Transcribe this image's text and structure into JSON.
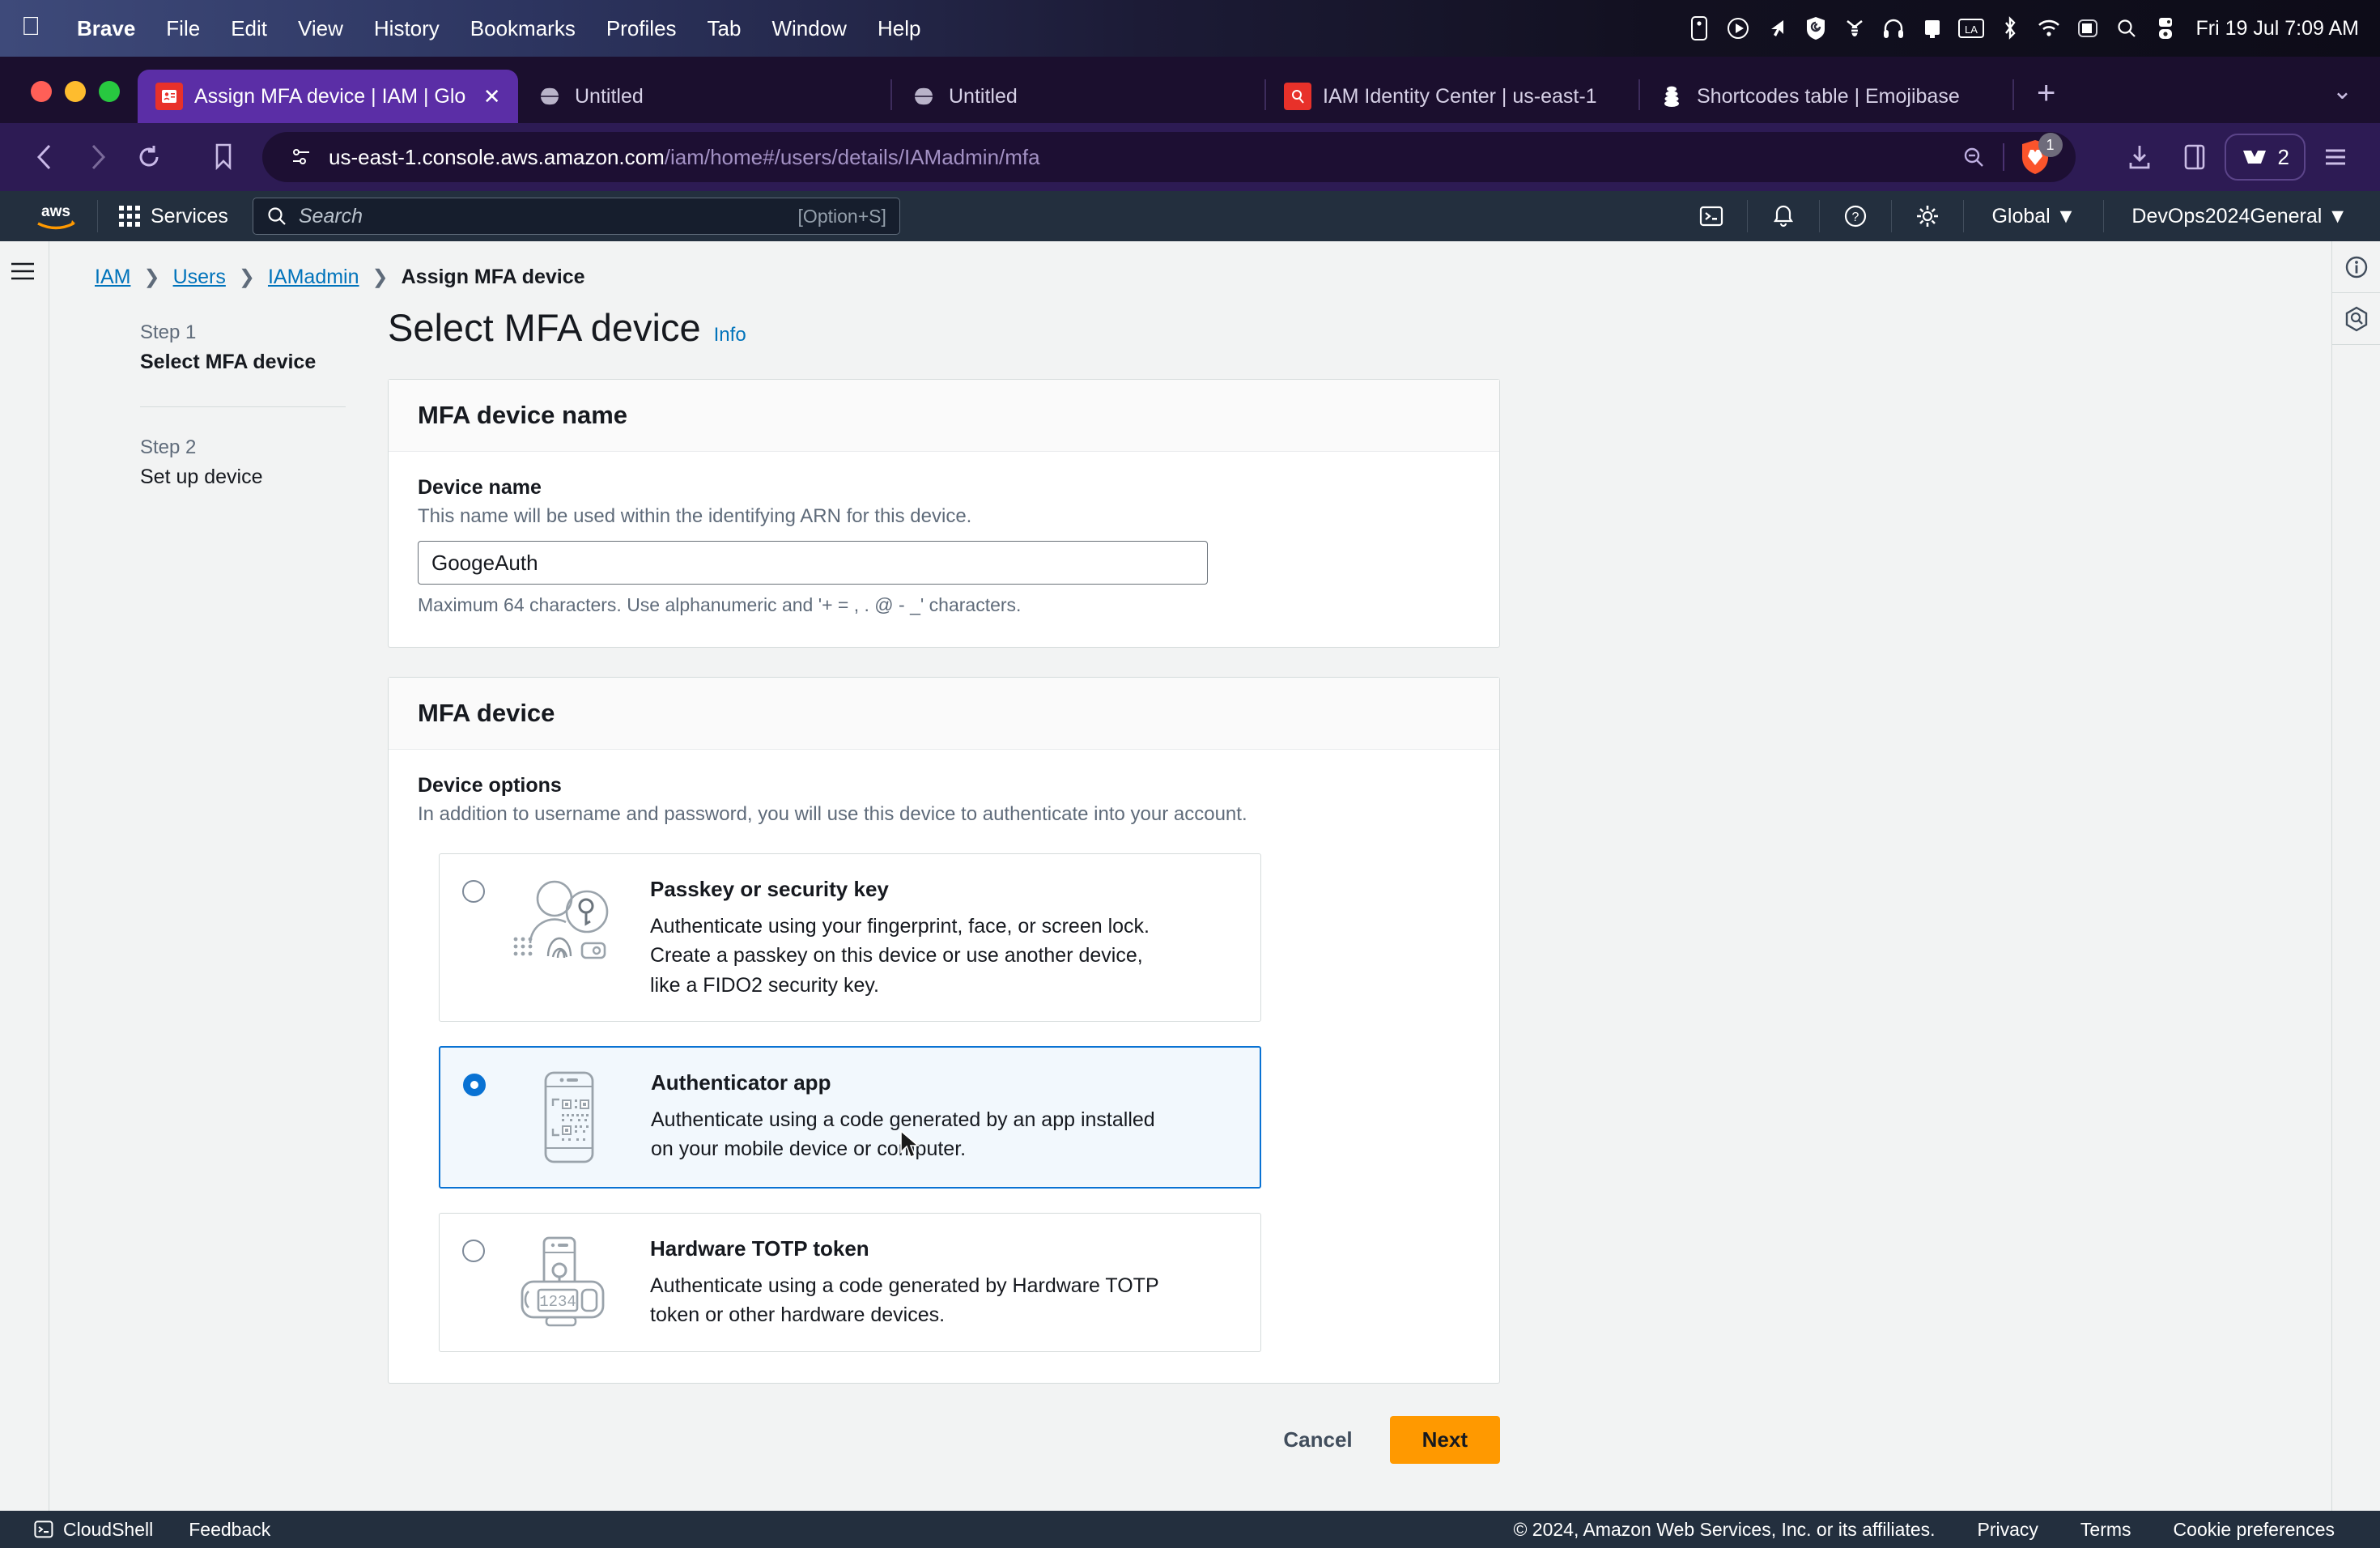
{
  "os_menubar": {
    "apple_icon": "apple-logo-icon",
    "items": [
      "Brave",
      "File",
      "Edit",
      "View",
      "History",
      "Bookmarks",
      "Profiles",
      "Tab",
      "Window",
      "Help"
    ],
    "status_icons": [
      "battery-case-icon",
      "play-circle-icon",
      "cursor-arrow-icon",
      "shield-swirl-icon",
      "bee-icon",
      "headphones-icon",
      "display-icon",
      "input-language-la-icon",
      "bluetooth-icon",
      "wifi-icon",
      "control-center-icon",
      "spotlight-search-icon",
      "siri-icon"
    ],
    "clock": "Fri 19 Jul 7:09 AM"
  },
  "browser": {
    "tabs": [
      {
        "title": "Assign MFA device | IAM | Glob",
        "favicon": "aws-iam-icon",
        "active": true,
        "close_label": "✕"
      },
      {
        "title": "Untitled",
        "favicon": "globe-icon",
        "active": false
      },
      {
        "title": "Untitled",
        "favicon": "globe-icon",
        "active": false
      },
      {
        "title": "IAM Identity Center | us-east-1",
        "favicon": "aws-iam-identity-center-icon",
        "active": false
      },
      {
        "title": "Shortcodes table | Emojibase",
        "favicon": "emojibase-icon",
        "active": false
      }
    ],
    "new_tab_label": "+",
    "tab_list_label": "⌄",
    "toolbar": {
      "back_label": "‹",
      "forward_label": "›",
      "reload_label": "⟳",
      "bookmark_label": "bookmark-icon",
      "url_host": "us-east-1.console.aws.amazon.com",
      "url_path": "/iam/home#/users/details/IAMadmin/mfa",
      "zoom_out_label": "zoom-out-icon",
      "brave_shields_count": "1",
      "downloads_label": "download-icon",
      "sidebar_label": "sidebar-icon",
      "brave_rewards_count": "2",
      "menu_label": "≡"
    }
  },
  "aws_header": {
    "logo": "aws-logo",
    "services_label": "Services",
    "search_placeholder": "Search",
    "search_shortcut": "[Option+S]",
    "cloudshell_label": "cloudshell-icon",
    "notifications_label": "bell-icon",
    "help_label": "question-circle-icon",
    "settings_label": "gear-icon",
    "region_label": "Global",
    "account_label": "DevOps2024General"
  },
  "breadcrumb": [
    {
      "label": "IAM",
      "link": true
    },
    {
      "label": "Users",
      "link": true
    },
    {
      "label": "IAMadmin",
      "link": true
    },
    {
      "label": "Assign MFA device",
      "link": false
    }
  ],
  "wizard": {
    "steps": [
      {
        "number": "Step 1",
        "title": "Select MFA device",
        "active": true
      },
      {
        "number": "Step 2",
        "title": "Set up device",
        "active": false
      }
    ]
  },
  "page": {
    "title": "Select MFA device",
    "info_label": "Info"
  },
  "device_name_section": {
    "heading": "MFA device name",
    "label": "Device name",
    "description": "This name will be used within the identifying ARN for this device.",
    "value": "GoogeAuth",
    "hint": "Maximum 64 characters. Use alphanumeric and '+ = , . @ - _' characters."
  },
  "mfa_device_section": {
    "heading": "MFA device",
    "label": "Device options",
    "description": "In addition to username and password, you will use this device to authenticate into your account.",
    "options": [
      {
        "id": "passkey",
        "title": "Passkey or security key",
        "description": "Authenticate using your fingerprint, face, or screen lock. Create a passkey on this device or use another device, like a FIDO2 security key.",
        "illustration": "passkey-illustration-icon",
        "selected": false
      },
      {
        "id": "authenticator-app",
        "title": "Authenticator app",
        "description": "Authenticate using a code generated by an app installed on your mobile device or computer.",
        "illustration": "phone-qr-illustration-icon",
        "selected": true
      },
      {
        "id": "hardware-totp",
        "title": "Hardware TOTP token",
        "description": "Authenticate using a code generated by Hardware TOTP token or other hardware devices.",
        "illustration": "hardware-token-illustration-icon",
        "token_display": "1234",
        "selected": false
      }
    ]
  },
  "actions": {
    "cancel_label": "Cancel",
    "next_label": "Next"
  },
  "right_rail": {
    "items": [
      "info-circle-icon",
      "cloud-search-icon"
    ]
  },
  "footer": {
    "cloudshell_label": "CloudShell",
    "feedback_label": "Feedback",
    "copyright": "© 2024, Amazon Web Services, Inc. or its affiliates.",
    "privacy_label": "Privacy",
    "terms_label": "Terms",
    "cookie_label": "Cookie preferences"
  },
  "colors": {
    "aws_orange": "#ff9900",
    "aws_navy": "#232f3e",
    "link_blue": "#0073bb",
    "selected_blue": "#0972d3",
    "brave_purple": "#2d1b54"
  }
}
